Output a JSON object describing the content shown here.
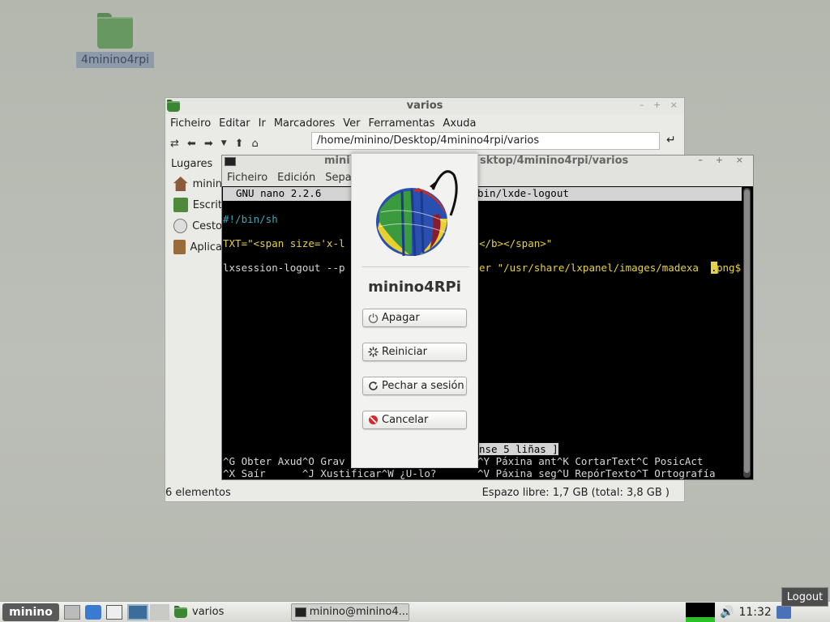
{
  "desktop": {
    "icon_label": "4minino4rpi"
  },
  "file_manager": {
    "title": "varios",
    "menu": [
      "Ficheiro",
      "Editar",
      "Ir",
      "Marcadores",
      "Ver",
      "Ferramentas",
      "Axuda"
    ],
    "path": "/home/minino/Desktop/4minino4rpi/varios",
    "sidebar_header": "Lugares",
    "sidebar_items": [
      "minin",
      "Escrit",
      "Cesto",
      "Aplica"
    ],
    "status_left": "6 elementos",
    "status_right": "Espazo libre: 1,7 GB (total: 3,8 GB )"
  },
  "terminal": {
    "title": "minino@minino4RPi: ~/Desktop/4minino4rpi/varios",
    "title_left": "mini",
    "title_right": "sktop/4minino4rpi/varios",
    "menu": [
      "Ficheiro",
      "Edición",
      "Separ"
    ],
    "nano_header_left": "GNU nano 2.2.6",
    "nano_header_right": "bin/lxde-logout",
    "lines": {
      "shebang": "#!/bin/sh",
      "txt_left": "TXT=\"<span size='x-l",
      "txt_right": "</b></span>\"",
      "cmd_left": "lxsession-logout --p",
      "cmd_mid": "er \"/usr/share/lxpanel/images/madexa",
      "cmd_cursor": ".",
      "cmd_end": "png$"
    },
    "status_msg": "nse 5 liñas ]",
    "shortcuts_row1_left": "^G Obter Axud^O Grav",
    "shortcuts_row1_right": "^Y Páxina ant^K CortarText^C PosicAct",
    "shortcuts_row2_left": "^X Saír      ^J Xustificar^W ¿U-lo?",
    "shortcuts_row2_right": "^V Páxina seg^U RepórTexto^T Ortografía"
  },
  "logout_dialog": {
    "name": "minino4RPi",
    "buttons": {
      "shutdown": "Apagar",
      "reboot": "Reiniciar",
      "logout": "Pechar a sesión",
      "cancel": "Cancelar"
    }
  },
  "taskbar": {
    "menu_label": "minino",
    "task_varios": "varios",
    "task_terminal": "minino@minino4...",
    "clock": "11:32",
    "tooltip": "Logout"
  },
  "colors": {
    "folder_green": "#3b8632",
    "cancel_red": "#d42a2a",
    "nano_green": "#7fd15a",
    "nano_yellow": "#e6d04a",
    "nano_comment": "#3ea9b8"
  }
}
